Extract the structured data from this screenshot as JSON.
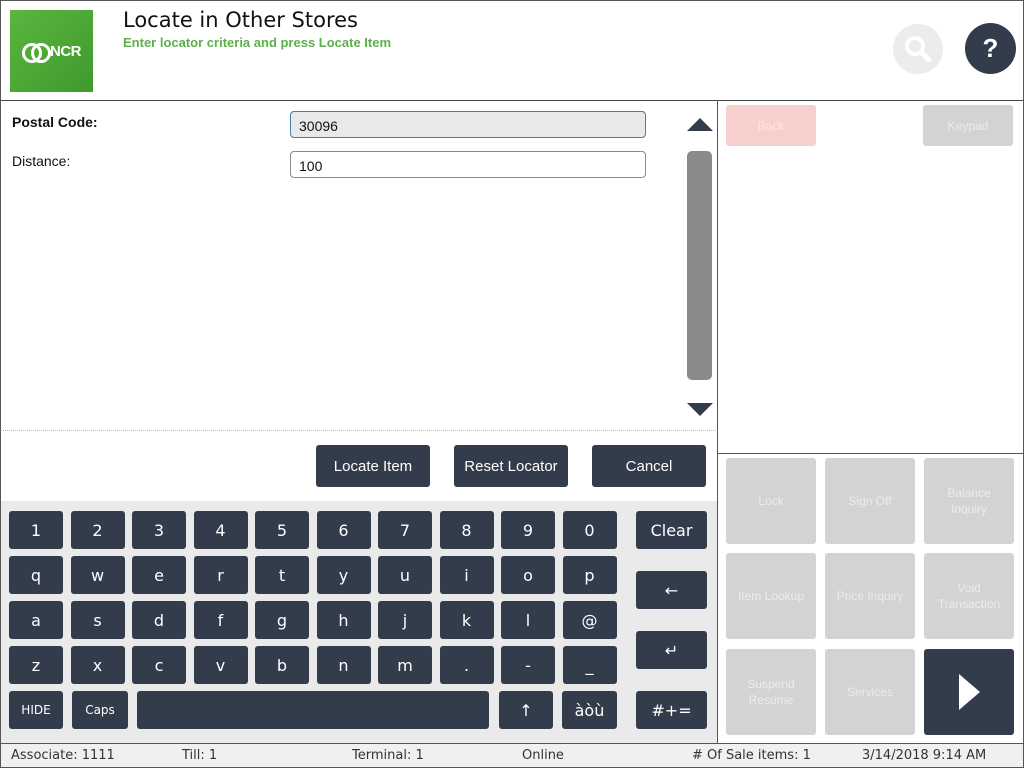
{
  "header": {
    "logo_text": "NCR",
    "title": "Locate in Other Stores",
    "subtitle": "Enter locator criteria and press Locate Item",
    "help_label": "?"
  },
  "form": {
    "postal_code_label": "Postal Code:",
    "postal_code_value": "30096",
    "distance_label": "Distance:",
    "distance_value": "100"
  },
  "actions": {
    "locate_item": "Locate Item",
    "reset_locator": "Reset Locator",
    "cancel": "Cancel"
  },
  "keyboard": {
    "row1": [
      "1",
      "2",
      "3",
      "4",
      "5",
      "6",
      "7",
      "8",
      "9",
      "0"
    ],
    "row2": [
      "q",
      "w",
      "e",
      "r",
      "t",
      "y",
      "u",
      "i",
      "o",
      "p"
    ],
    "row3": [
      "a",
      "s",
      "d",
      "f",
      "g",
      "h",
      "j",
      "k",
      "l",
      "@"
    ],
    "row4": [
      "z",
      "x",
      "c",
      "v",
      "b",
      "n",
      "m",
      ".",
      "-",
      "_"
    ],
    "hide": "HIDE",
    "caps": "Caps",
    "shift_symbol": "↑",
    "accents": "àòù",
    "clear": "Clear",
    "backspace_symbol": "←",
    "enter_symbol": "↵",
    "symbols": "#+="
  },
  "right_panel": {
    "back": "Back",
    "keypad": "Keypad",
    "lock": "Lock",
    "sign_off": "Sign Off",
    "balance_inquiry": "Balance Inquiry",
    "item_lookup": "Item Lookup",
    "price_inquiry": "Price Inquiry",
    "void_transaction": "Void Transaction",
    "suspend_resume": "Suspend Resume",
    "services": "Services"
  },
  "status_bar": {
    "associate": "Associate: 1111",
    "till": "Till: 1",
    "terminal": "Terminal: 1",
    "connection": "Online",
    "sale_items": "# Of Sale items: 1",
    "datetime": "3/14/2018 9:14 AM"
  },
  "colors": {
    "brand_green": "#5cb04a",
    "button_dark": "#333c4a",
    "disabled_gray": "#d3d3d3"
  }
}
